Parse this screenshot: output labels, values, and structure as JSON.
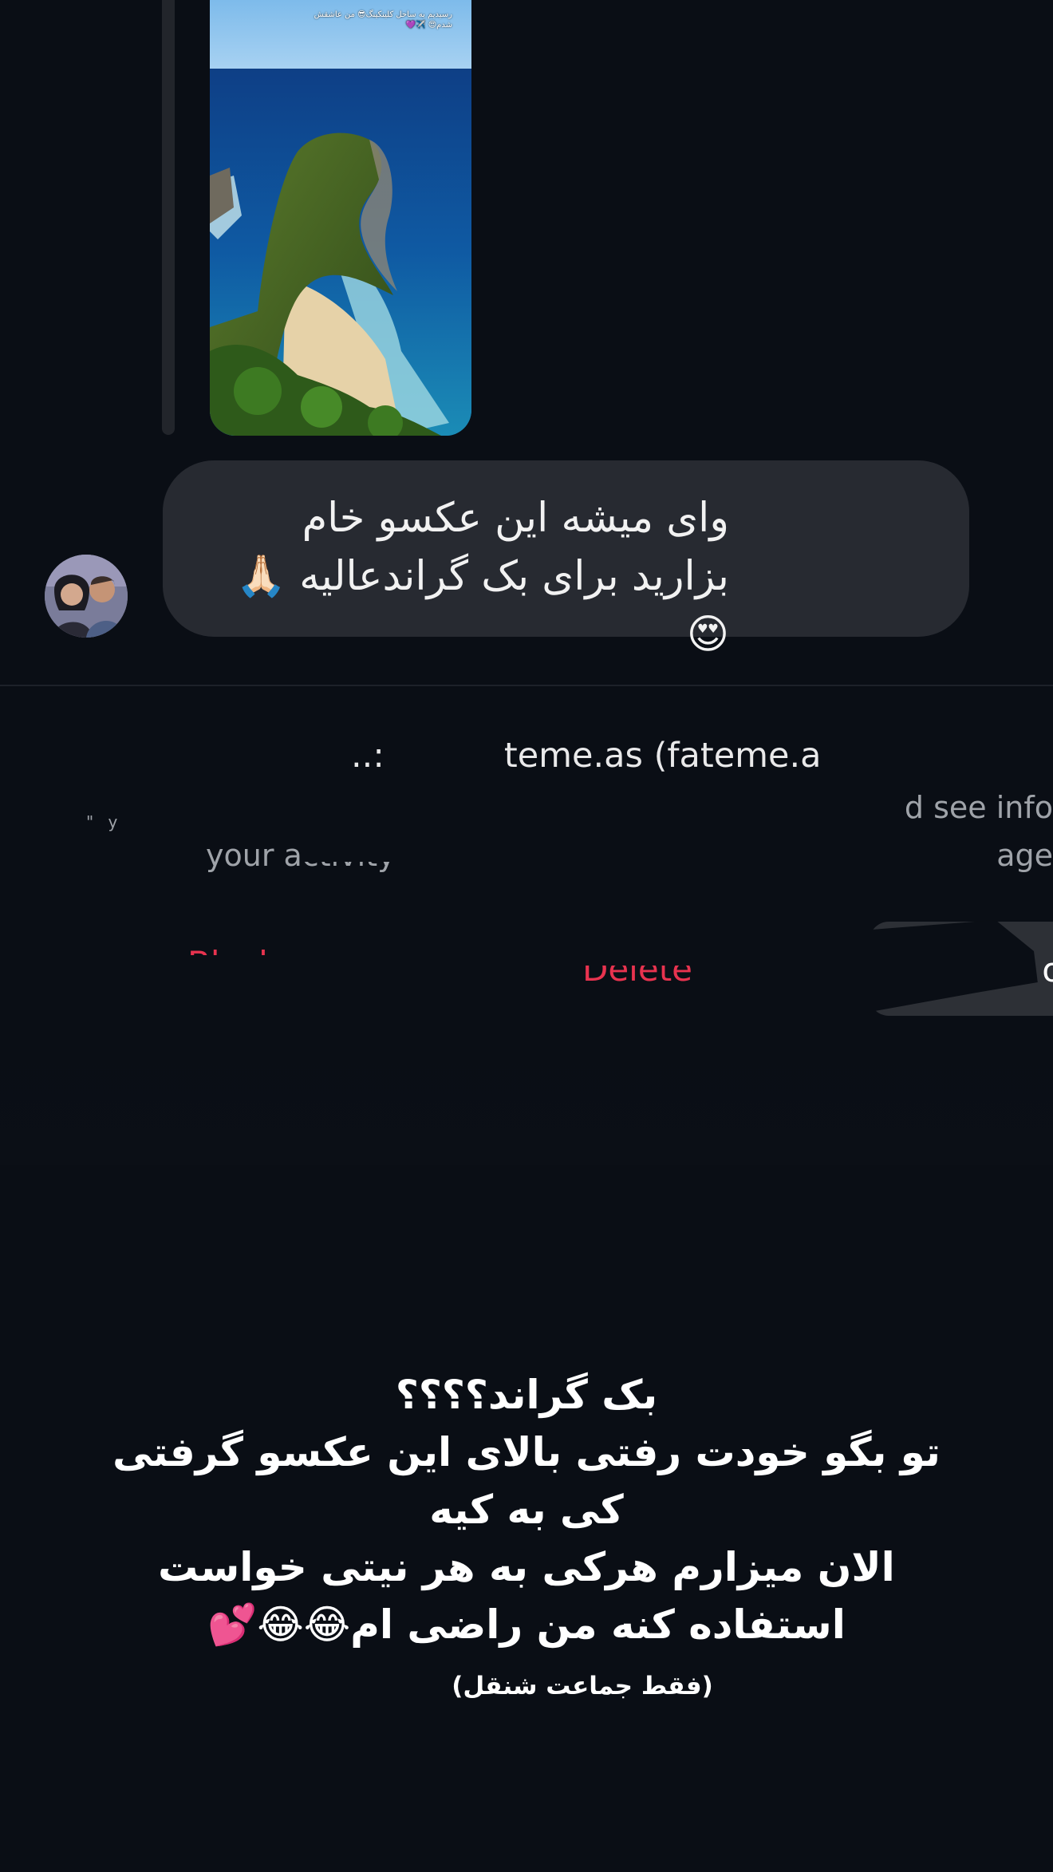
{
  "story_reply": {
    "caption": "رسیدیم به ساحل کلینکینگ😎 من عاشقش شدم😍 ✈️💜",
    "message": "وای میشه این عکسو خام بزارید برای بک گراندعالیه 🙏🏻 😍"
  },
  "message_request": {
    "title_partial": "teme.as (fateme.a",
    "info_partial": "d see info",
    "activity_partial": "your activity",
    "activity_tail": "age",
    "block_label": "Block",
    "delete_label": "Delete",
    "accept_label": "Accept"
  },
  "caption": {
    "lines": [
      "بک گراند؟؟؟؟",
      "تو بگو خودت رفتی بالای این عکسو گرفتی",
      "کی به کیه",
      "الان میزارم هرکی به هر نیتی خواست",
      "استفاده کنه من راضی ام😂😂💕"
    ],
    "note": "(فقط جماعت شنقل)"
  },
  "colors": {
    "background": "#0a0e15",
    "bubble": "#272a31",
    "danger": "#e8334f"
  }
}
